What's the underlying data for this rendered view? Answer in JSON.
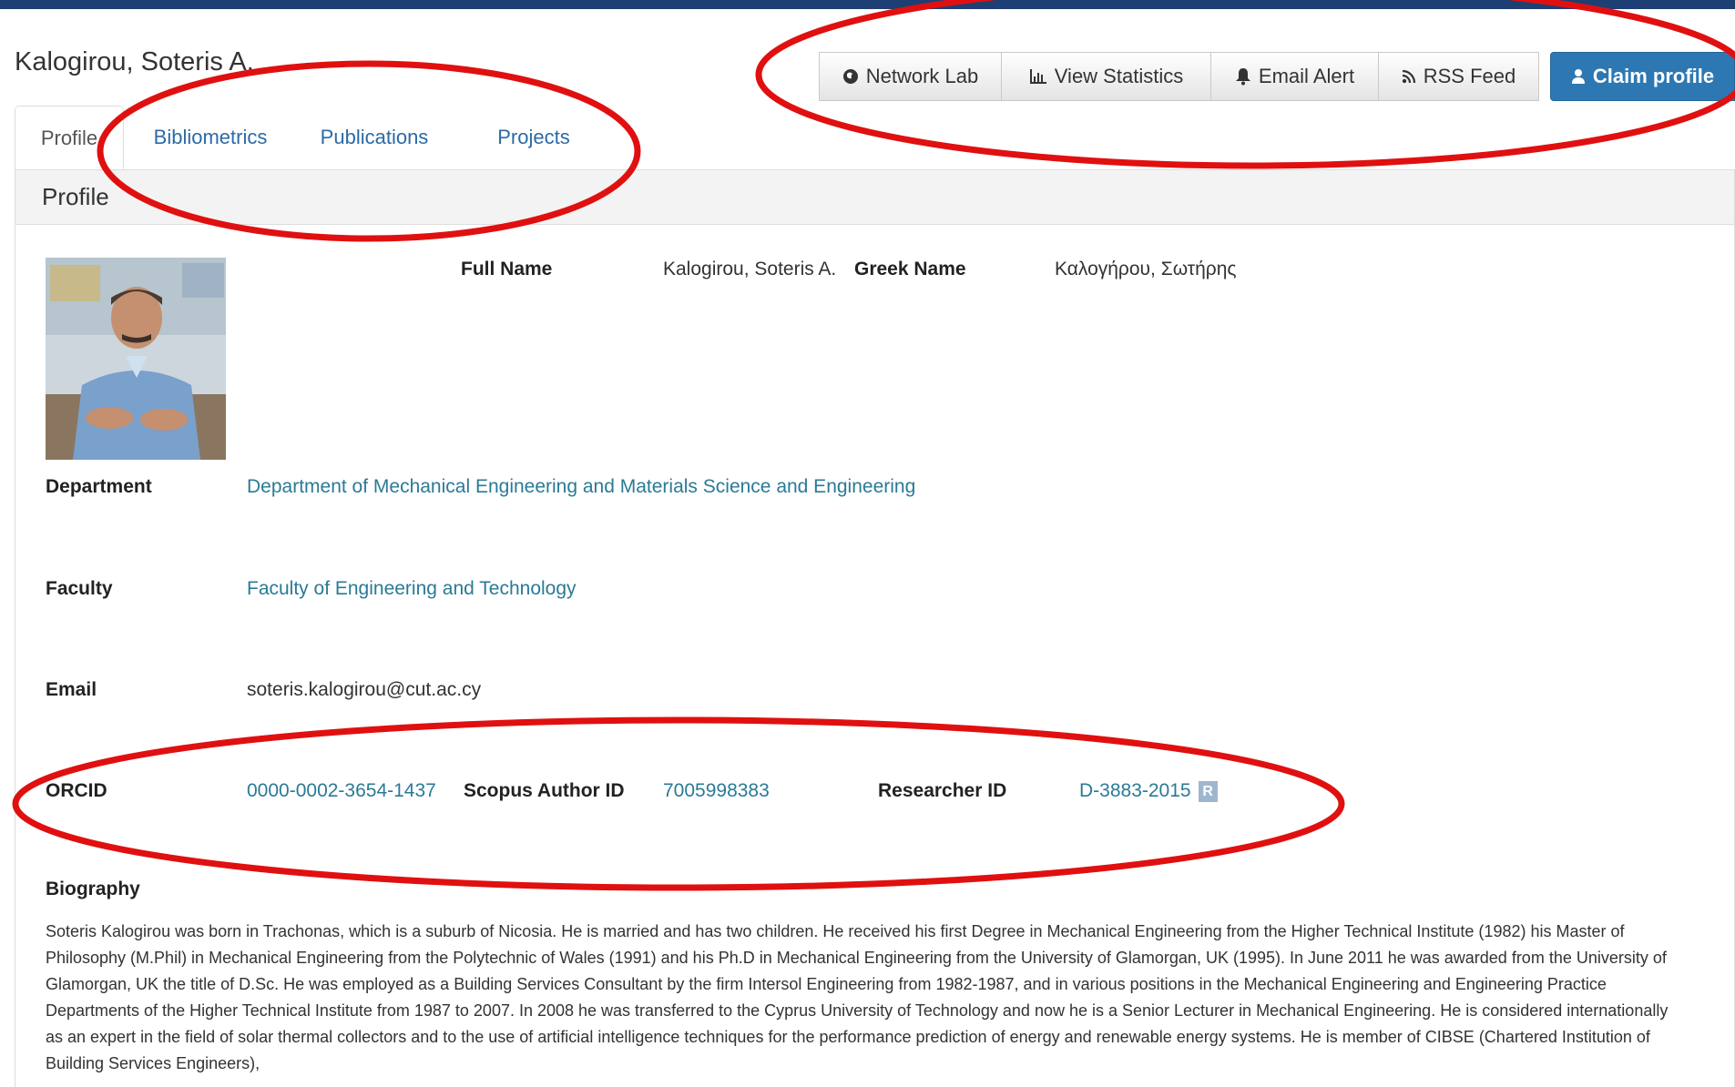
{
  "header": {
    "author_name": "Kalogirou, Soteris A.",
    "accent_color": "#1d3f73"
  },
  "actions": [
    {
      "label": "Network Lab",
      "icon": "globe-icon"
    },
    {
      "label": "View Statistics",
      "icon": "bar-chart-icon"
    },
    {
      "label": "Email Alert",
      "icon": "bell-icon"
    },
    {
      "label": "RSS Feed",
      "icon": "rss-icon"
    }
  ],
  "claim": {
    "label": "Claim profile",
    "icon": "user-icon",
    "color": "#2d78b2"
  },
  "tabs": [
    {
      "label": "Profile",
      "active": true
    },
    {
      "label": "Bibliometrics",
      "active": false
    },
    {
      "label": "Publications",
      "active": false
    },
    {
      "label": "Projects",
      "active": false
    }
  ],
  "panel": {
    "title": "Profile"
  },
  "profile": {
    "photo_icon": "profile-photo",
    "full_name_label": "Full Name",
    "full_name": "Kalogirou, Soteris A.",
    "greek_name_label": "Greek Name",
    "greek_name": "Καλογήρου, Σωτήρης",
    "department_label": "Department",
    "department": "Department of Mechanical Engineering and Materials Science and Engineering",
    "faculty_label": "Faculty",
    "faculty": "Faculty of Engineering and Technology",
    "email_label": "Email",
    "email": "soteris.kalogirou@cut.ac.cy",
    "orcid_label": "ORCID",
    "orcid": "0000-0002-3654-1437",
    "scopus_label": "Scopus Author ID",
    "scopus": "7005998383",
    "researcher_label": "Researcher ID",
    "researcher": "D-3883-2015",
    "researcher_icon": "researcherid-icon",
    "researcher_icon_text": "R"
  },
  "biography": {
    "heading": "Biography",
    "text": "Soteris Kalogirou was born in Trachonas, which is a suburb of Nicosia. He is married and has two children. He received his first Degree in Mechanical Engineering from the Higher Technical Institute (1982) his Master of Philosophy (M.Phil) in Mechanical Engineering from the Polytechnic of Wales (1991) and his Ph.D in Mechanical Engineering from the University of Glamorgan, UK (1995). In June 2011 he was awarded from the University of Glamorgan, UK the title of D.Sc. He was employed as a Building Services Consultant by the firm Intersol Engineering from 1982-1987, and in various positions in the Mechanical Engineering and Engineering Practice Departments of the Higher Technical Institute from 1987 to 2007. In 2008 he was transferred to the Cyprus University of Technology and now he is a Senior Lecturer in Mechanical Engineering. He is considered internationally as an expert in the field of solar thermal collectors and to the use of artificial intelligence techniques for the performance prediction of energy and renewable energy systems. He is member of CIBSE (Chartered Institution of Building Services Engineers),"
  },
  "annotation": {
    "color": "#e01010"
  }
}
